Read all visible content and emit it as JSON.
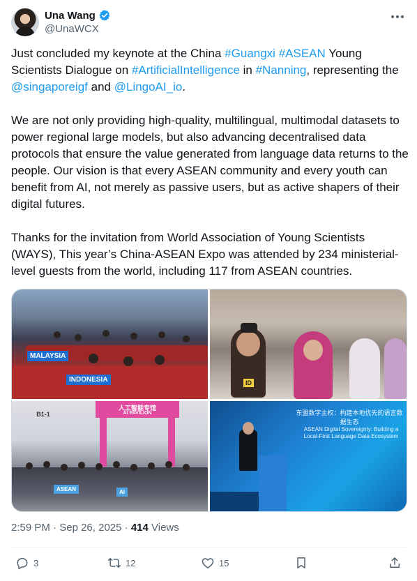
{
  "author": {
    "display_name": "Una Wang",
    "handle": "@UnaWCX"
  },
  "tweet": {
    "p1": {
      "t1": "Just concluded my keynote at the China ",
      "h1": "#Guangxi",
      "t2": " ",
      "h2": "#ASEAN",
      "t3": " Young Scientists Dialogue on ",
      "h3": "#ArtificialIntelligence",
      "t4": " in ",
      "h4": "#Nanning",
      "t5": ", representing the ",
      "m1": "@singaporeigf",
      "t6": " and ",
      "m2": "@LingoAI_io",
      "t7": "."
    },
    "p2": "We are not only providing high-quality, multilingual, multimodal datasets to power regional large models, but also advancing decentralised data protocols that ensure the value generated from language data returns to the people. Our vision is that every ASEAN community and every youth can benefit from AI, not merely as passive users, but as active shapers of their digital futures.",
    "p3": "Thanks for the invitation from World Association of Young Scientists (WAYS), This year’s China-ASEAN Expo was attended by 234 ministerial-level guests from the world, including 117 from ASEAN countries."
  },
  "photos": {
    "p1_banner_a": "MALAYSIA",
    "p1_banner_b": "INDONESIA",
    "p3_gate": "人工智能专馆",
    "p3_gate_sub": "AI PAVILION",
    "p3_gate_code": "B1-1",
    "p4_title_cn": "东盟数字主权：构建本地优先的语言数据生态",
    "p4_title_en": "ASEAN Digital Sovereignty: Building a Local-First Language Data Ecosystem"
  },
  "meta": {
    "time": "2:59 PM",
    "sep1": " · ",
    "date": "Sep 26, 2025",
    "sep2": " · ",
    "views_count": "414",
    "views_label": " Views"
  },
  "actions": {
    "replies": "3",
    "reposts": "12",
    "likes": "15"
  },
  "colors": {
    "link": "#1d9bf0",
    "secondary_text": "#536471",
    "verified": "#1d9bf0"
  },
  "icons": [
    "verified-badge-icon",
    "more-icon",
    "reply-icon",
    "repost-icon",
    "like-icon",
    "bookmark-icon",
    "share-icon"
  ]
}
